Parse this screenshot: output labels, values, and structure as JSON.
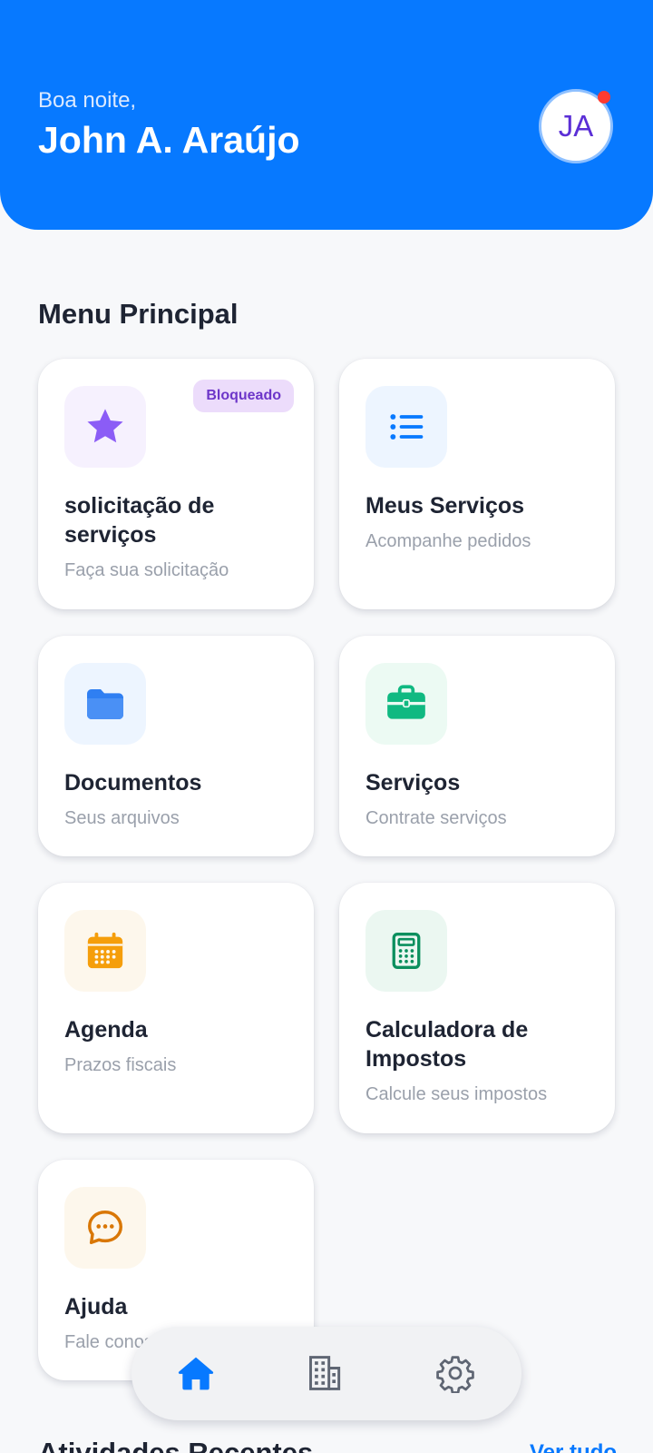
{
  "header": {
    "greeting": "Boa noite,",
    "user_name": "John A. Araújo",
    "avatar_initials": "JA",
    "notification_dot_color": "#ff3b30",
    "background_color": "#0779ff"
  },
  "menu": {
    "title": "Menu Principal",
    "cards": [
      {
        "title": "solicitação de serviços",
        "subtitle": "Faça sua solicitação",
        "icon": "star-icon",
        "badge": "Bloqueado"
      },
      {
        "title": "Meus Serviços",
        "subtitle": "Acompanhe pedidos",
        "icon": "list-icon"
      },
      {
        "title": "Documentos",
        "subtitle": "Seus arquivos",
        "icon": "folder-icon"
      },
      {
        "title": "Serviços",
        "subtitle": "Contrate serviços",
        "icon": "briefcase-icon"
      },
      {
        "title": "Agenda",
        "subtitle": "Prazos fiscais",
        "icon": "calendar-icon"
      },
      {
        "title": "Calculadora de Impostos",
        "subtitle": "Calcule seus impostos",
        "icon": "calculator-icon"
      },
      {
        "title": "Ajuda",
        "subtitle": "Fale conosco",
        "icon": "chat-icon"
      }
    ]
  },
  "bottom_nav": {
    "items": [
      "home-icon",
      "building-icon",
      "settings-icon"
    ],
    "active": "home-icon"
  },
  "recent": {
    "title": "Atividades Recentes",
    "see_all": "Ver tudo"
  }
}
